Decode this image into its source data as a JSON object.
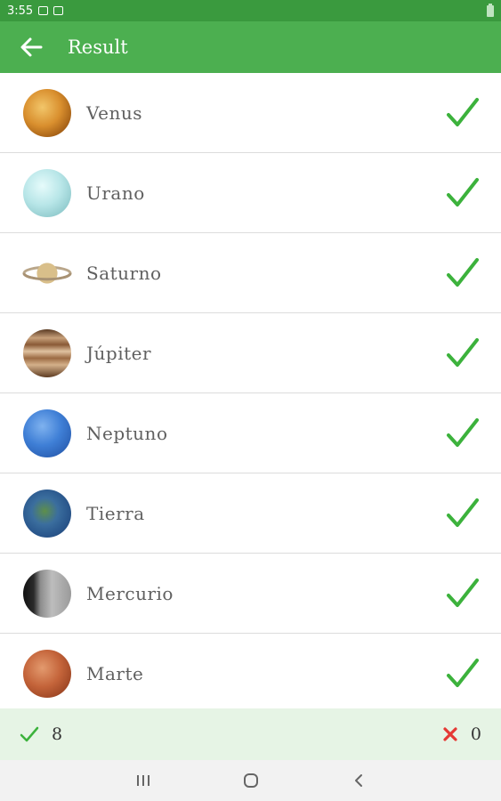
{
  "status_bar": {
    "time": "3:55"
  },
  "app_bar": {
    "title": "Result"
  },
  "results": [
    {
      "name": "Venus",
      "icon": "venus-icon",
      "correct": true
    },
    {
      "name": "Urano",
      "icon": "uranus-icon",
      "correct": true
    },
    {
      "name": "Saturno",
      "icon": "saturn-icon",
      "correct": true
    },
    {
      "name": "Júpiter",
      "icon": "jupiter-icon",
      "correct": true
    },
    {
      "name": "Neptuno",
      "icon": "neptune-icon",
      "correct": true
    },
    {
      "name": "Tierra",
      "icon": "earth-icon",
      "correct": true
    },
    {
      "name": "Mercurio",
      "icon": "mercury-icon",
      "correct": true
    },
    {
      "name": "Marte",
      "icon": "mars-icon",
      "correct": true
    }
  ],
  "footer": {
    "correct_count": "8",
    "wrong_count": "0"
  },
  "colors": {
    "primary": "#4caf50",
    "status_bar": "#3a9a3e",
    "check": "#3cb23c",
    "wrong": "#e53935",
    "footer_bg": "#e6f4e5"
  }
}
